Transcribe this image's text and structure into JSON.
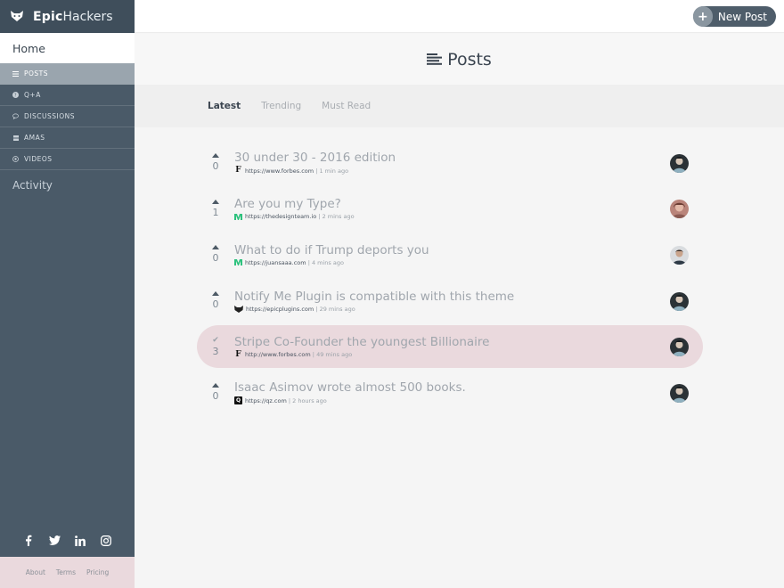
{
  "brand": {
    "name_bold": "Epic",
    "name_light": "Hackers"
  },
  "sidebar": {
    "home": "Home",
    "items": [
      {
        "label": "POSTS",
        "icon": "list-icon"
      },
      {
        "label": "Q+A",
        "icon": "question-icon"
      },
      {
        "label": "DISCUSSIONS",
        "icon": "chat-icon"
      },
      {
        "label": "AMAS",
        "icon": "grid-icon"
      },
      {
        "label": "VIDEOS",
        "icon": "play-icon"
      }
    ],
    "activity": "Activity"
  },
  "social": [
    "facebook-icon",
    "twitter-icon",
    "linkedin-icon",
    "instagram-icon"
  ],
  "footer": {
    "about": "About",
    "terms": "Terms",
    "pricing": "Pricing"
  },
  "topbar": {
    "new_post": "New Post"
  },
  "page": {
    "title": "Posts"
  },
  "tabs": [
    "Latest",
    "Trending",
    "Must Read"
  ],
  "posts": [
    {
      "title": "30 under 30 - 2016 edition",
      "url": "https://www.forbes.com",
      "time": "1 min ago",
      "votes": "0",
      "source": "forbes",
      "voted": false
    },
    {
      "title": "Are you my Type?",
      "url": "https://thedesignteam.io",
      "time": "2 mins ago",
      "votes": "1",
      "source": "medium",
      "voted": false
    },
    {
      "title": "What to do if Trump deports you",
      "url": "https://juansaaa.com",
      "time": "4 mins ago",
      "votes": "0",
      "source": "medium",
      "voted": false
    },
    {
      "title": "Notify Me Plugin is compatible with this theme",
      "url": "https://epicplugins.com",
      "time": "29 mins ago",
      "votes": "0",
      "source": "epic",
      "voted": false
    },
    {
      "title": "Stripe Co-Founder the youngest Billionaire",
      "url": "http://www.forbes.com",
      "time": "49 mins ago",
      "votes": "3",
      "source": "forbes",
      "voted": true
    },
    {
      "title": "Isaac Asimov wrote almost 500 books.",
      "url": "https://qz.com",
      "time": "2 hours ago",
      "votes": "0",
      "source": "qz",
      "voted": false
    }
  ],
  "colors": {
    "sidebar": "#4a5a68",
    "highlight": "#ead9dd",
    "accent": "#4e5d6a"
  }
}
